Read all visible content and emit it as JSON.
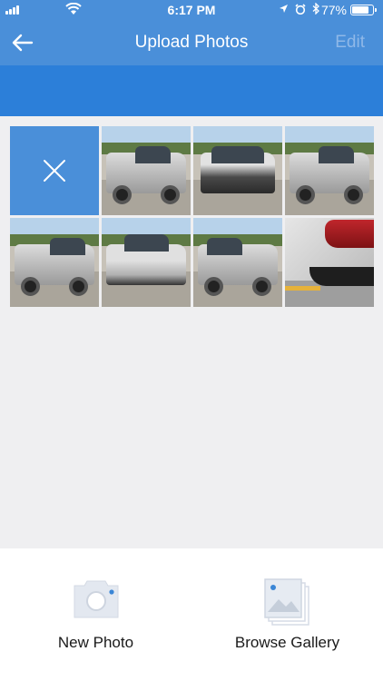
{
  "status_bar": {
    "time": "6:17 PM",
    "battery": "77%",
    "battery_fraction": 0.77
  },
  "nav": {
    "title": "Upload Photos",
    "edit_label": "Edit",
    "back_icon": "arrow-left-icon"
  },
  "grid": {
    "delete_icon": "close-icon",
    "photos": [
      {
        "kind": "side",
        "label": "silver pickup truck front three-quarter view"
      },
      {
        "kind": "front",
        "label": "silver pickup truck front view"
      },
      {
        "kind": "side",
        "label": "silver pickup truck side view"
      },
      {
        "kind": "side",
        "label": "silver pickup truck rear three-quarter view"
      },
      {
        "kind": "rear",
        "label": "silver pickup truck rear view"
      },
      {
        "kind": "side",
        "label": "silver pickup truck rear side view"
      },
      {
        "kind": "closeup",
        "label": "taillight and rear bumper close-up"
      }
    ]
  },
  "actions": {
    "new_photo_label": "New Photo",
    "browse_gallery_label": "Browse Gallery"
  },
  "colors": {
    "brand_blue": "#4a8fd9",
    "sub_bar_blue": "#2c7fd9",
    "background": "#efeff1"
  }
}
